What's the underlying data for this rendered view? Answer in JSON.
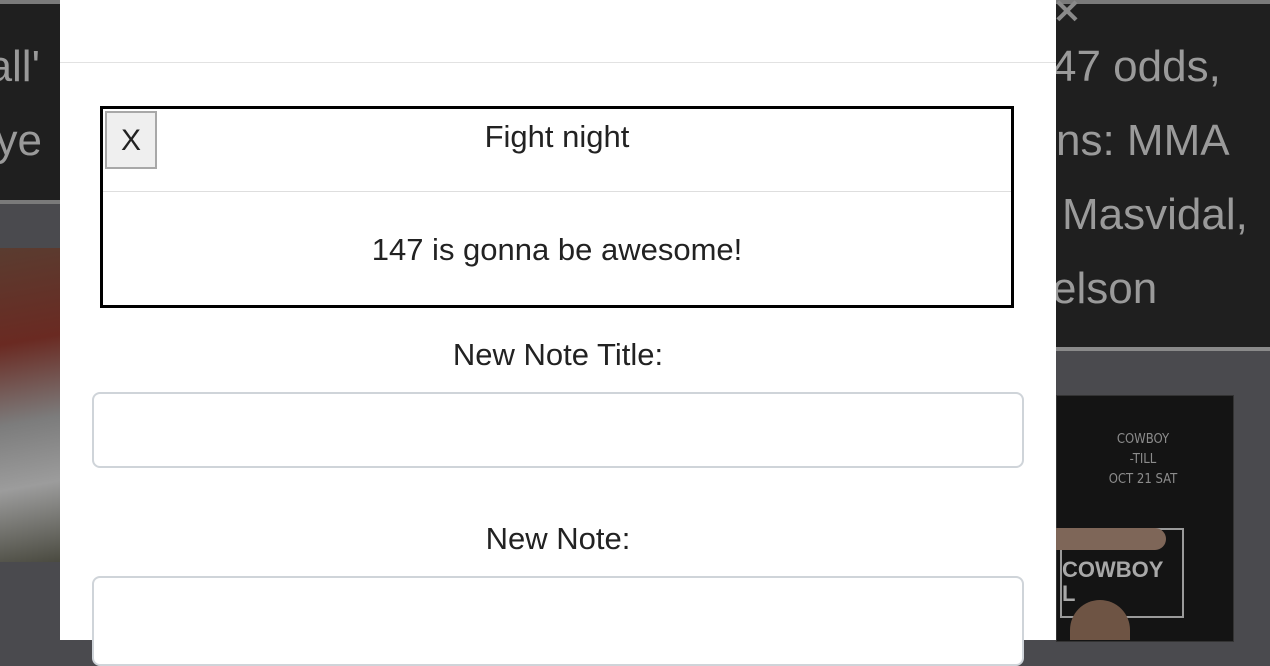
{
  "background": {
    "lines": [
      {
        "left": "ball'",
        "right": "47 odds,"
      },
      {
        "left": "aye",
        "right": "ns: MMA"
      },
      {
        "left": "",
        "right": "Masvidal,"
      },
      {
        "left": "",
        "right": "elson"
      }
    ],
    "poster_text": [
      "COWBOY",
      "-TILL",
      "OCT 21 SAT"
    ],
    "poster_belt_text": [
      "COWBOY",
      "L"
    ]
  },
  "modal": {
    "close_icon": "×",
    "note": {
      "delete_label": "X",
      "title": "Fight night",
      "body": "147 is gonna be awesome!"
    },
    "form": {
      "title_label": "New Note Title:",
      "title_value": "",
      "body_label": "New Note:",
      "body_value": ""
    }
  }
}
